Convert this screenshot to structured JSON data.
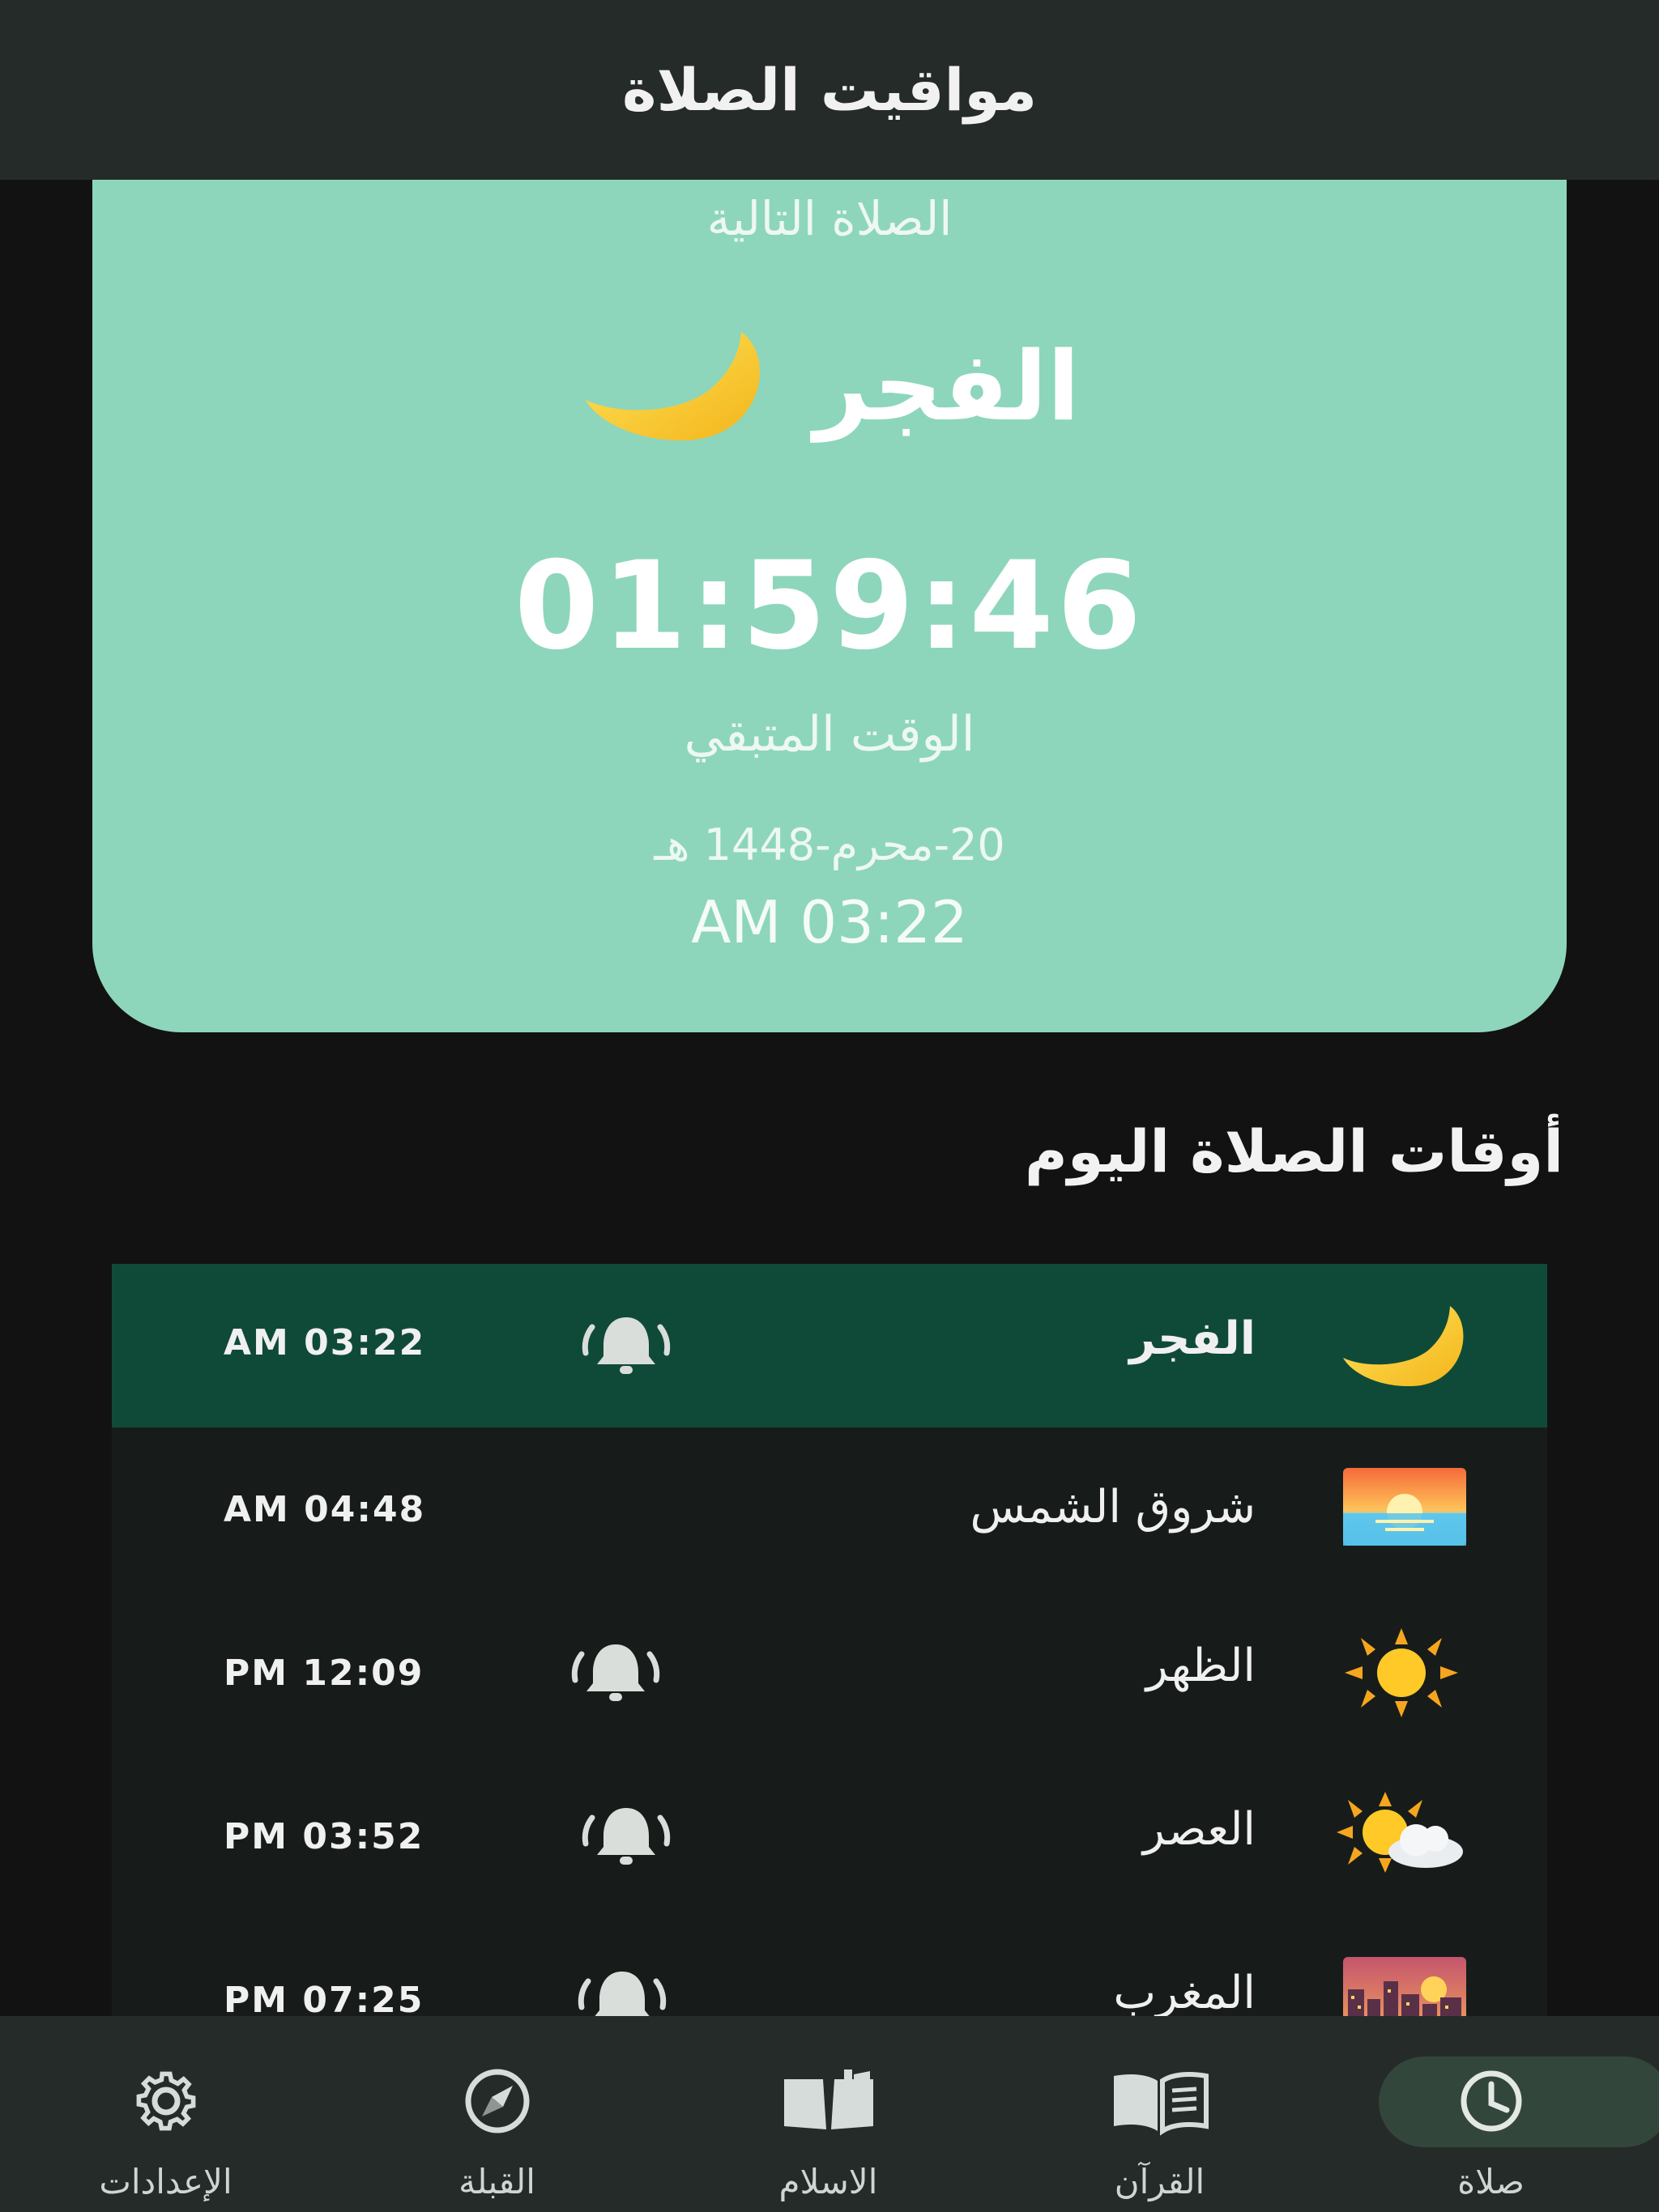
{
  "header": {
    "title": "مواقيت الصلاة"
  },
  "next_prayer": {
    "label": "الصلاة التالية",
    "name": "الفجر",
    "countdown": "01:59:46",
    "remaining_label": "الوقت المتبقي",
    "hijri_date": "20-محرم-1448 هـ",
    "time": "AM 03:22"
  },
  "today": {
    "title": "أوقات الصلاة اليوم",
    "prayers": [
      {
        "name": "الفجر",
        "time": "AM 03:22",
        "icon": "crescent-moon-icon",
        "alarm": true,
        "active": true
      },
      {
        "name": "شروق الشمس",
        "time": "AM 04:48",
        "icon": "sunrise-icon",
        "alarm": false,
        "active": false
      },
      {
        "name": "الظهر",
        "time": "PM 12:09",
        "icon": "sun-icon",
        "alarm": true,
        "active": false
      },
      {
        "name": "العصر",
        "time": "PM 03:52",
        "icon": "sun-behind-cloud-icon",
        "alarm": true,
        "active": false
      },
      {
        "name": "المغرب",
        "time": "PM 07:25",
        "icon": "city-sunset-icon",
        "alarm": true,
        "active": false
      }
    ]
  },
  "nav": {
    "items": [
      {
        "label": "الإعدادات",
        "icon": "gear-icon"
      },
      {
        "label": "القبلة",
        "icon": "compass-icon"
      },
      {
        "label": "الاسلام",
        "icon": "open-book-icon"
      },
      {
        "label": "القرآن",
        "icon": "quran-book-icon"
      },
      {
        "label": "صلاة",
        "icon": "clock-icon",
        "selected": true
      }
    ]
  },
  "colors": {
    "accent": "#8dd6bc",
    "active_row": "#0f4a39",
    "bar": "#252b28",
    "background": "#121212"
  }
}
